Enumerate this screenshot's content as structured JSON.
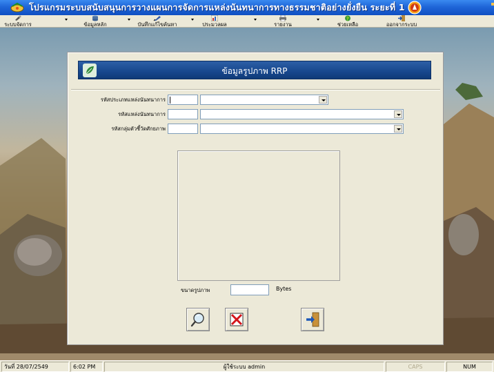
{
  "window": {
    "title": "โปรแกรมระบบสนับสนุนการวางแผนการจัดการแหล่งนันทนาการทางธรรมชาติอย่างยั่งยืน ระยะที่ 1"
  },
  "toolbar": {
    "items": [
      {
        "label": "ระบบจัดการ",
        "icon": "tools-icon"
      },
      {
        "label": "ข้อมูลหลัก",
        "icon": "database-icon"
      },
      {
        "label": "บันทึกแก้ไขค้นหา",
        "icon": "edit-icon"
      },
      {
        "label": "ประมวลผล",
        "icon": "chart-icon"
      },
      {
        "label": "รายงาน",
        "icon": "printer-icon"
      },
      {
        "label": "ช่วยเหลือ",
        "icon": "help-icon"
      },
      {
        "label": "ออกจากระบบ",
        "icon": "exit-icon"
      }
    ]
  },
  "form": {
    "title": "ข้อมูลรูปภาพ RRP",
    "fields": {
      "type_label": "รหัสประเภทแหล่งนันทนาการ",
      "site_label": "รหัสแหล่งนันทนาการ",
      "indicator_label": "รหัสกลุ่มตัวชี้วัดศักยภาพ"
    },
    "image_size_label": "ขนาดรูปภาพ",
    "image_size_value": "",
    "bytes_label": "Bytes",
    "buttons": {
      "browse": "magnifier-icon",
      "delete": "delete-x-icon",
      "exit": "exit-arrow-icon"
    }
  },
  "statusbar": {
    "date": "วันที่ 28/07/2549",
    "time": "6:02 PM",
    "user": "ผู้ใช้ระบบ admin",
    "caps": "CAPS",
    "num": "NUM"
  },
  "colors": {
    "titlebar": "#1f66d8",
    "header": "#17478d",
    "panel": "#ece9d8"
  }
}
